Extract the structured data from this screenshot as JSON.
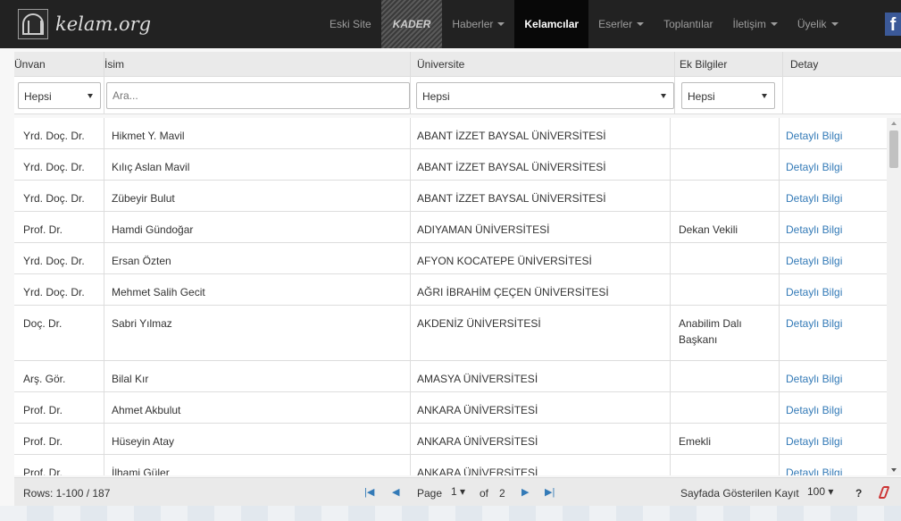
{
  "brand": {
    "text": "kelam.org"
  },
  "nav": {
    "items": [
      {
        "label": "Eski Site",
        "caret": false
      },
      {
        "label": "KADER",
        "caret": false
      },
      {
        "label": "Haberler",
        "caret": true
      },
      {
        "label": "Kelamcılar",
        "caret": false
      },
      {
        "label": "Eserler",
        "caret": true
      },
      {
        "label": "Toplantılar",
        "caret": false
      },
      {
        "label": "İletişim",
        "caret": true
      },
      {
        "label": "Üyelik",
        "caret": true
      }
    ],
    "facebook": "f"
  },
  "table": {
    "headers": [
      "Ünvan",
      "İsim",
      "Üniversite",
      "Ek Bilgiler",
      "Detay"
    ],
    "filters": {
      "unvan": "Hepsi",
      "isim_placeholder": "Ara...",
      "universite": "Hepsi",
      "ek_bilgiler": "Hepsi"
    },
    "rows": [
      {
        "unvan": "Yrd. Doç. Dr.",
        "isim": "Hikmet Y. Mavil",
        "universite": "ABANT İZZET BAYSAL ÜNİVERSİTESİ",
        "ek": [],
        "detay": "Detaylı Bilgi"
      },
      {
        "unvan": "Yrd. Doç. Dr.",
        "isim": "Kılıç Aslan Mavil",
        "universite": "ABANT İZZET BAYSAL ÜNİVERSİTESİ",
        "ek": [],
        "detay": "Detaylı Bilgi"
      },
      {
        "unvan": "Yrd. Doç. Dr.",
        "isim": "Zübeyir Bulut",
        "universite": "ABANT İZZET BAYSAL ÜNİVERSİTESİ",
        "ek": [],
        "detay": "Detaylı Bilgi"
      },
      {
        "unvan": "Prof. Dr.",
        "isim": "Hamdi Gündoğar",
        "universite": "ADIYAMAN ÜNİVERSİTESİ",
        "ek": [
          "Dekan Vekili"
        ],
        "detay": "Detaylı Bilgi"
      },
      {
        "unvan": "Yrd. Doç. Dr.",
        "isim": "Ersan Özten",
        "universite": "AFYON KOCATEPE ÜNİVERSİTESİ",
        "ek": [],
        "detay": "Detaylı Bilgi"
      },
      {
        "unvan": "Yrd. Doç. Dr.",
        "isim": "Mehmet Salih Gecit",
        "universite": "AĞRI İBRAHİM ÇEÇEN ÜNİVERSİTESİ",
        "ek": [],
        "detay": "Detaylı Bilgi"
      },
      {
        "unvan": "Doç. Dr.",
        "isim": "Sabri Yılmaz",
        "universite": "AKDENİZ ÜNİVERSİTESİ",
        "ek": [
          "Anabilim Dalı",
          "Başkanı"
        ],
        "detay": "Detaylı Bilgi"
      },
      {
        "unvan": "Arş. Gör.",
        "isim": "Bilal Kır",
        "universite": "AMASYA ÜNİVERSİTESİ",
        "ek": [],
        "detay": "Detaylı Bilgi"
      },
      {
        "unvan": "Prof. Dr.",
        "isim": "Ahmet Akbulut",
        "universite": "ANKARA ÜNİVERSİTESİ",
        "ek": [],
        "detay": "Detaylı Bilgi"
      },
      {
        "unvan": "Prof. Dr.",
        "isim": "Hüseyin Atay",
        "universite": "ANKARA ÜNİVERSİTESİ",
        "ek": [
          "Emekli"
        ],
        "detay": "Detaylı Bilgi"
      },
      {
        "unvan": "Prof. Dr.",
        "isim": "İlhami Güler",
        "universite": "ANKARA ÜNİVERSİTESİ",
        "ek": [],
        "detay": "Detaylı Bilgi"
      }
    ]
  },
  "pager": {
    "rows_info": "Rows: 1-100 / 187",
    "page_label": "Page",
    "page_value": "1",
    "of_label": "of",
    "total_pages": "2",
    "per_page_label": "Sayfada Gösterilen Kayıt",
    "per_page_value": "100",
    "help": "?"
  },
  "icons": [
    "first-page-icon",
    "prev-page-icon",
    "next-page-icon",
    "last-page-icon",
    "reset-filter-icon",
    "facebook-icon",
    "logo-icon"
  ]
}
